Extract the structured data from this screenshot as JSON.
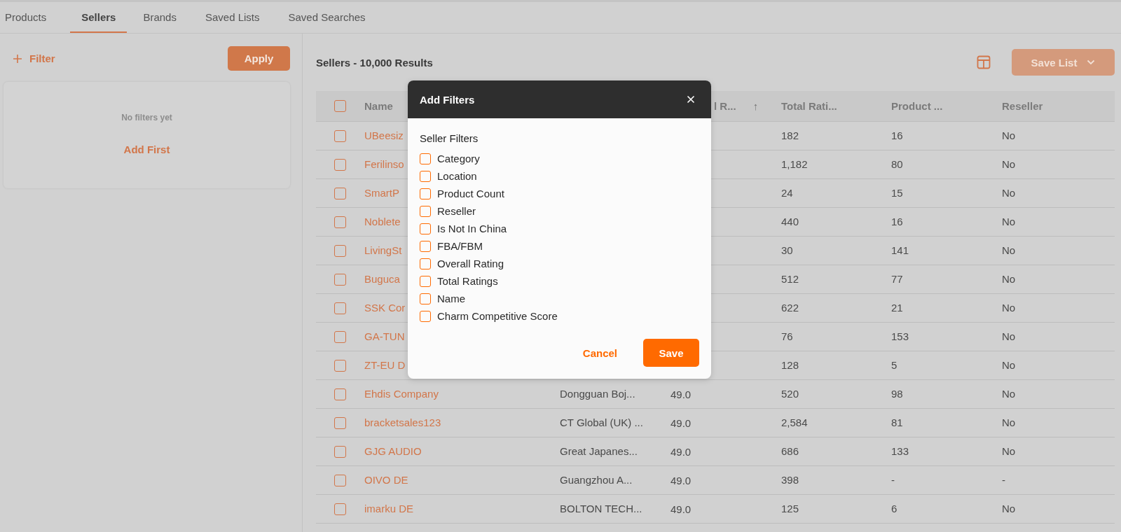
{
  "tabs": [
    {
      "label": "Products",
      "selected": false
    },
    {
      "label": "Sellers",
      "selected": true
    },
    {
      "label": "Brands",
      "selected": false
    },
    {
      "label": "Saved Lists",
      "selected": false
    },
    {
      "label": "Saved Searches",
      "selected": false
    }
  ],
  "filter_panel": {
    "add_filter": "Filter",
    "apply": "Apply",
    "empty_text": "No filters yet",
    "add_first": "Add First"
  },
  "results": {
    "title": "Sellers - 10,000 Results",
    "save_list": "Save List"
  },
  "table": {
    "select_all_checked": false,
    "columns": [
      {
        "label": "Name"
      },
      {},
      {
        "label": "l R...",
        "sort_icon": "↑"
      },
      {
        "label": "Total Rati..."
      },
      {
        "label": "Product ..."
      },
      {
        "label": "Reseller"
      }
    ],
    "rows": [
      {
        "selected": false,
        "cells": [
          "UBeesiz",
          "",
          "",
          "182",
          "16",
          "No"
        ]
      },
      {
        "selected": false,
        "cells": [
          "Ferilinso",
          "",
          "",
          "1,182",
          "80",
          "No"
        ]
      },
      {
        "selected": false,
        "cells": [
          "SmartP",
          "",
          "",
          "24",
          "15",
          "No"
        ]
      },
      {
        "selected": false,
        "cells": [
          "Noblete",
          "",
          "",
          "440",
          "16",
          "No"
        ]
      },
      {
        "selected": false,
        "cells": [
          "LivingSt",
          "",
          "",
          "30",
          "141",
          "No"
        ]
      },
      {
        "selected": false,
        "cells": [
          "Buguca",
          "",
          "",
          "512",
          "77",
          "No"
        ]
      },
      {
        "selected": false,
        "cells": [
          "SSK Cor",
          "",
          "",
          "622",
          "21",
          "No"
        ]
      },
      {
        "selected": false,
        "cells": [
          "GA-TUN",
          "",
          "",
          "76",
          "153",
          "No"
        ]
      },
      {
        "selected": false,
        "cells": [
          "ZT-EU D",
          "",
          "",
          "128",
          "5",
          "No"
        ]
      },
      {
        "selected": false,
        "cells": [
          "Ehdis Company",
          "Dongguan Boj...",
          "49.0",
          "520",
          "98",
          "No"
        ]
      },
      {
        "selected": false,
        "cells": [
          "bracketsales123",
          "CT Global (UK) ...",
          "49.0",
          "2,584",
          "81",
          "No"
        ]
      },
      {
        "selected": false,
        "cells": [
          "GJG AUDIO",
          "Great Japanes...",
          "49.0",
          "686",
          "133",
          "No"
        ]
      },
      {
        "selected": false,
        "cells": [
          "OIVO DE",
          "Guangzhou A...",
          "49.0",
          "398",
          "-",
          "-"
        ]
      },
      {
        "selected": false,
        "cells": [
          "imarku DE",
          "BOLTON TECH...",
          "49.0",
          "125",
          "6",
          "No"
        ]
      }
    ]
  },
  "modal": {
    "title": "Add Filters",
    "section": "Seller Filters",
    "options": [
      {
        "label": "Category",
        "checked": false
      },
      {
        "label": "Location",
        "checked": false
      },
      {
        "label": "Product Count",
        "checked": false
      },
      {
        "label": "Reseller",
        "checked": false
      },
      {
        "label": "Is Not In China",
        "checked": false
      },
      {
        "label": "FBA/FBM",
        "checked": false
      },
      {
        "label": "Overall Rating",
        "checked": false
      },
      {
        "label": "Total Ratings",
        "checked": false
      },
      {
        "label": "Name",
        "checked": false
      },
      {
        "label": "Charm Competitive Score",
        "checked": false
      }
    ],
    "cancel": "Cancel",
    "save": "Save"
  }
}
